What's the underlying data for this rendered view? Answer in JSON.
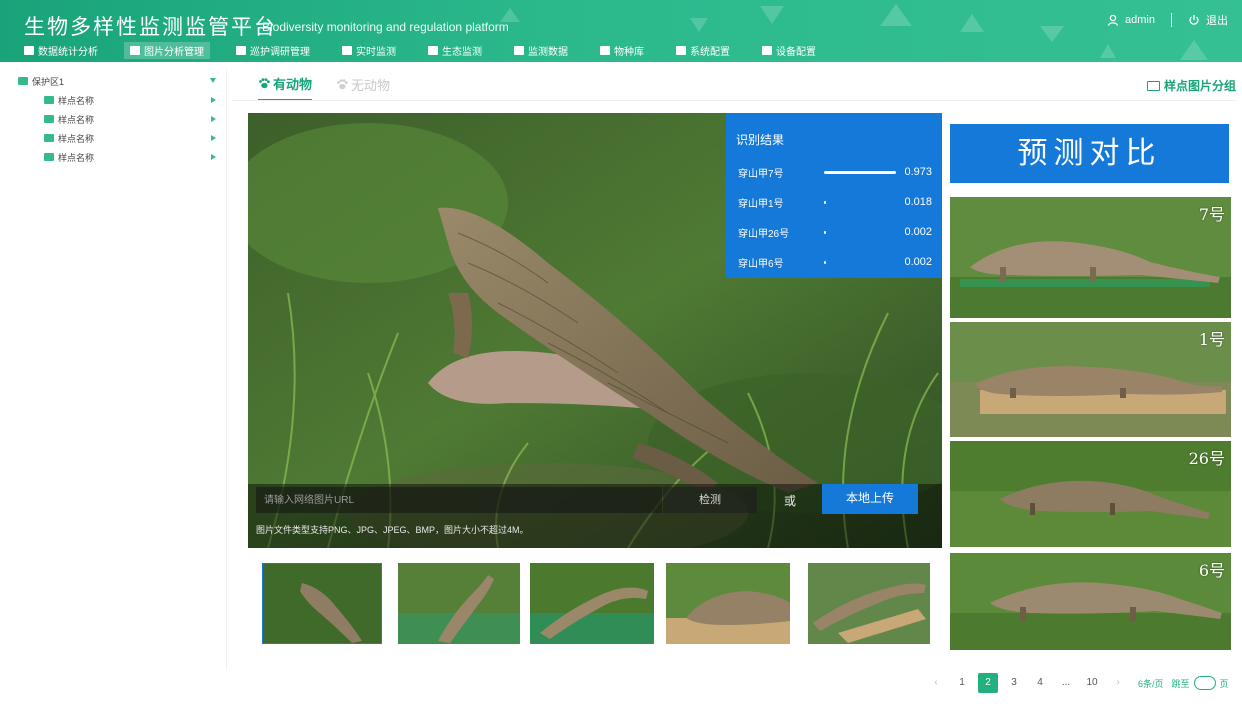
{
  "header": {
    "title_cn": "生物多样性监测监管平台",
    "title_en": "Biodiversity monitoring and regulation platform",
    "user": "admin",
    "logout": "退出"
  },
  "nav": [
    {
      "label": "数据统计分析",
      "icon": "chart-icon"
    },
    {
      "label": "图片分析管理",
      "icon": "image-icon",
      "active": true
    },
    {
      "label": "巡护调研管理",
      "icon": "patrol-icon"
    },
    {
      "label": "实时监测",
      "icon": "camera-icon"
    },
    {
      "label": "生态监测",
      "icon": "paw-icon"
    },
    {
      "label": "监测数据",
      "icon": "data-icon"
    },
    {
      "label": "物种库",
      "icon": "book-icon"
    },
    {
      "label": "系统配置",
      "icon": "config-icon"
    },
    {
      "label": "设备配置",
      "icon": "device-icon"
    }
  ],
  "tree": {
    "root": "保护区1",
    "children": [
      "样点名称",
      "样点名称",
      "样点名称",
      "样点名称"
    ]
  },
  "tabs": {
    "with_animal": "有动物",
    "without_animal": "无动物",
    "group_link": "样点图片分组"
  },
  "result": {
    "title": "识别结果",
    "items": [
      {
        "name": "穿山甲7号",
        "score": 0.973,
        "score_text": "0.973"
      },
      {
        "name": "穿山甲1号",
        "score": 0.018,
        "score_text": "0.018"
      },
      {
        "name": "穿山甲26号",
        "score": 0.002,
        "score_text": "0.002"
      },
      {
        "name": "穿山甲6号",
        "score": 0.002,
        "score_text": "0.002"
      }
    ]
  },
  "upload": {
    "placeholder": "请输入网络图片URL",
    "detect": "检测",
    "or": "或",
    "local_upload": "本地上传",
    "hint": "图片文件类型支持PNG、JPG、JPEG、BMP，图片大小不超过4M。"
  },
  "compare": {
    "title": "预测对比",
    "cards": [
      "7号",
      "1号",
      "26号",
      "6号"
    ]
  },
  "pagination": {
    "prev": "‹",
    "next": "›",
    "pages": [
      "1",
      "2",
      "3",
      "4",
      "...",
      "10"
    ],
    "active": "2",
    "page_size": "6条/页",
    "jump_label": "跳至",
    "jump_suffix": "页"
  },
  "colors": {
    "brand_green": "#1aa37a",
    "accent_blue": "#1579d9"
  }
}
